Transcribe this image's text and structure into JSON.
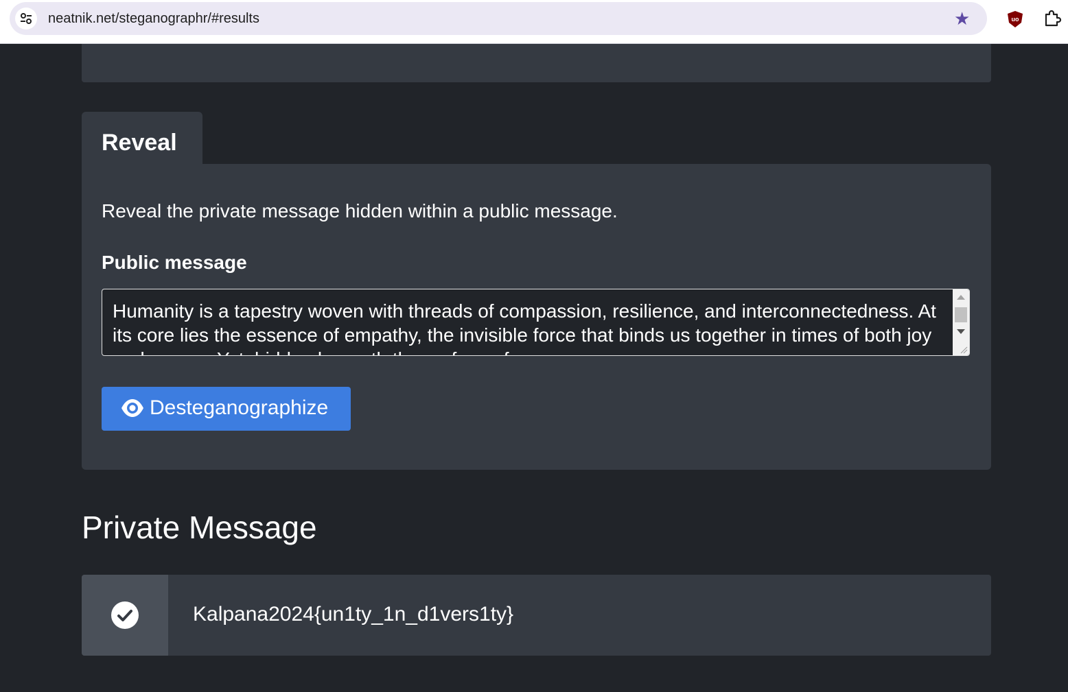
{
  "browser": {
    "url": "neatnik.net/steganographr/#results"
  },
  "reveal": {
    "tab_label": "Reveal",
    "description": "Reveal the private message hidden within a public message.",
    "public_message_label": "Public message",
    "public_message_value": "Humanity is a tapestry woven with threads of compassion, resilience, and interconnectedness. At its core lies the essence of empathy, the invisible force that binds us together in times of both joy and sorrow. Yet, hidden beneath the surface of our",
    "button_label": "Desteganographize"
  },
  "result": {
    "title": "Private Message",
    "message": "Kalpana2024{un1ty_1n_d1vers1ty}"
  },
  "colors": {
    "page_bg": "#212429",
    "card_bg": "#353a42",
    "button_bg": "#3d7de0"
  }
}
